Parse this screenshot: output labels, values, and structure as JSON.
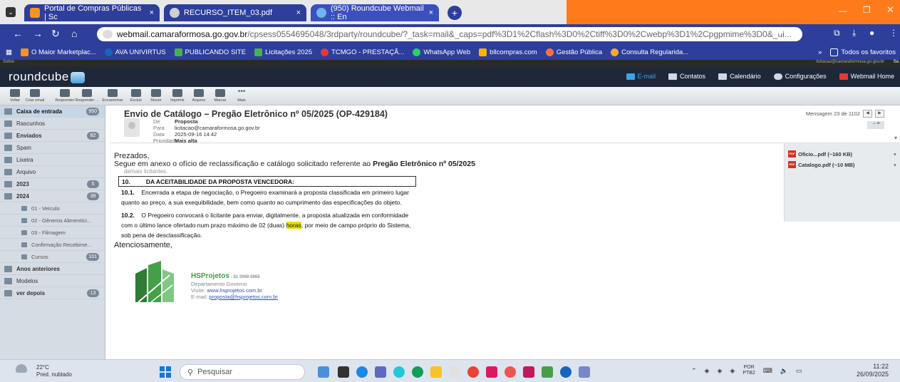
{
  "browser": {
    "tabs": [
      {
        "label": "Portal de Compras Públicas | Sc",
        "close": "×"
      },
      {
        "label": "RECURSO_ITEM_03.pdf",
        "close": "×"
      },
      {
        "label": "(950) Roundcube Webmail :: En",
        "close": "×"
      }
    ],
    "new_tab": "+",
    "url_host": "webmail.camaraformosa.go.gov.br",
    "url_path": "/cpsess0554695048/3rdparty/roundcube/?_task=mail&_caps=pdf%3D1%2Cflash%3D0%2Ctiff%3D0%2Cwebp%3D1%2Cpgpmime%3D0&_ui...",
    "bookmarks": [
      "O Maior Marketplac...",
      "AVA UNIVIRTUS",
      "PUBLICANDO SITE",
      "Licitações 2025",
      "TCMGO - PRESTAÇÃ...",
      "WhatsApp Web",
      "bllcompras.com",
      "Gestão Pública",
      "Consulta Regularida..."
    ],
    "all_bookmarks": "Todos os favoritos",
    "bookmarks_more": "»"
  },
  "roundcube": {
    "strip_left": "Sobre",
    "strip_right": "licitacao@camaraformosa.go.gov.br",
    "strip_logout": "Sa",
    "logo": "roundcube",
    "nav": [
      "E-mail",
      "Contatos",
      "Calendário",
      "Configurações",
      "Webmail Home"
    ],
    "toolbar": [
      "Voltar",
      "Criar email",
      "Responder",
      "Responder ...",
      "Encaminhar",
      "Excluir",
      "Mover",
      "Imprimir",
      "Arquivo",
      "Marcar",
      "Mais"
    ]
  },
  "folders": [
    {
      "label": "Caixa de entrada",
      "count": "950",
      "bold": true,
      "selected": true,
      "sub": false
    },
    {
      "label": "Rascunhos",
      "count": "",
      "bold": false,
      "selected": false,
      "sub": false
    },
    {
      "label": "Enviados",
      "count": "82",
      "bold": true,
      "selected": false,
      "sub": false
    },
    {
      "label": "Spam",
      "count": "",
      "bold": false,
      "selected": false,
      "sub": false
    },
    {
      "label": "Lixeira",
      "count": "",
      "bold": false,
      "selected": false,
      "sub": false
    },
    {
      "label": "Arquivo",
      "count": "",
      "bold": false,
      "selected": false,
      "sub": false
    },
    {
      "label": "2023",
      "count": "5",
      "bold": true,
      "selected": false,
      "sub": false
    },
    {
      "label": "2024",
      "count": "39",
      "bold": true,
      "selected": false,
      "sub": false
    },
    {
      "label": "01 - Veículo",
      "count": "",
      "bold": false,
      "selected": false,
      "sub": true
    },
    {
      "label": "02 - Gêneros Alimentíci...",
      "count": "",
      "bold": false,
      "selected": false,
      "sub": true
    },
    {
      "label": "03 - Filmagem",
      "count": "",
      "bold": false,
      "selected": false,
      "sub": true
    },
    {
      "label": "Confirmação Recebime...",
      "count": "",
      "bold": false,
      "selected": false,
      "sub": true
    },
    {
      "label": "Cursos",
      "count": "101",
      "bold": false,
      "selected": false,
      "sub": true
    },
    {
      "label": "Anos anteriores",
      "count": "",
      "bold": true,
      "selected": false,
      "sub": false
    },
    {
      "label": "Modelos",
      "count": "",
      "bold": false,
      "selected": false,
      "sub": false
    },
    {
      "label": "ver depois",
      "count": "13",
      "bold": true,
      "selected": false,
      "sub": false
    }
  ],
  "message": {
    "subject": "Envio de Catálogo – Pregão Eletrônico nº 05/2025 (OP-429184)",
    "from_label": "De",
    "from": "Proposta",
    "to_label": "Para",
    "to": "licitacao@camaraformosa.go.gov.br",
    "date_label": "Data",
    "date": "2025-09-16 14:42",
    "priority_label": "Prioridade",
    "priority": "Mais alta",
    "count": "Mensagem 23 de 1102",
    "greeting": "Prezados,",
    "intro": "Segue em anexo o ofício de reclassificação e catálogo solicitado referente ao ",
    "intro_bold": "Pregão Eletrônico nº 05/2025",
    "faded": "demais licitantes.",
    "section_num": "10.",
    "section_title": "DA ACEITABILIDADE DA PROPOSTA VENCEDORA:",
    "p1_num": "10.1.",
    "p1_text": "Encerrada a etapa de negociação, o Pregoeiro examinará a proposta classificada em primeiro lugar quanto ao preço, a sua exequibilidade, bem como quanto ao cumprimento das especificações do objeto.",
    "p2_num": "10.2.",
    "p2_text_a": "O Pregoeiro convocará o licitante para enviar, digitalmente, a proposta atualizada em conformidade com o último lance ofertado num prazo máximo de 02 (duas) ",
    "p2_highlight": "horas",
    "p2_text_b": ", por meio de campo próprio do Sistema, sob pena de desclassificação.",
    "closing": "Atenciosamente,",
    "sig_name": "HSProjetos",
    "sig_phone": "- 61 3968-9868",
    "sig_dept": "Departamento Governo",
    "sig_site_label": "Visite: ",
    "sig_site": "www.hsprojetos.com.br",
    "sig_email_label": "E-mail: ",
    "sig_email": "proposta@hsprojetos.com.br"
  },
  "attachments": [
    {
      "name": "Oficio...pdf (~160 KB)",
      "icon": "PDF"
    },
    {
      "name": "Catalogo.pdf (~10 MB)",
      "icon": "PDF"
    }
  ],
  "taskbar": {
    "temp": "22°C",
    "weather": "Pred. nublado",
    "search": "Pesquisar",
    "lang": "POR",
    "kbd": "PTB2",
    "time": "11:22",
    "date": "26/09/2025"
  },
  "colors": {
    "accent": "#2d3e9b",
    "tab_orange": "#ff7a1a",
    "roundcube_header": "#1e2838",
    "highlight": "#e7e100"
  }
}
